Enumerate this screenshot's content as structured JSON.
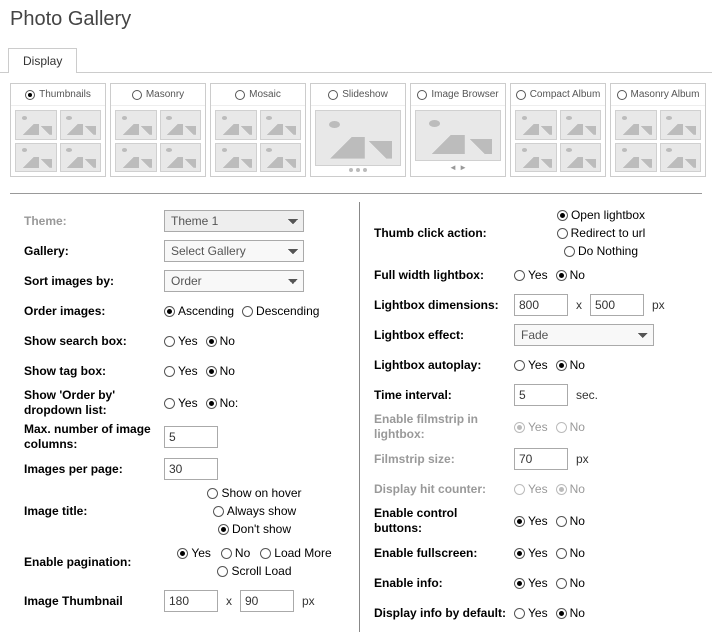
{
  "page_title": "Photo Gallery",
  "tab_display": "Display",
  "view_types": [
    {
      "label": "Thumbnails",
      "selected": true,
      "layout": "grid2x2"
    },
    {
      "label": "Masonry",
      "selected": false,
      "layout": "grid2x2"
    },
    {
      "label": "Mosaic",
      "selected": false,
      "layout": "grid2x2"
    },
    {
      "label": "Slideshow",
      "selected": false,
      "layout": "single_dots"
    },
    {
      "label": "Image Browser",
      "selected": false,
      "layout": "single_arrows"
    },
    {
      "label": "Compact Album",
      "selected": false,
      "layout": "grid2x2"
    },
    {
      "label": "Masonry Album",
      "selected": false,
      "layout": "grid2x2"
    }
  ],
  "left": {
    "theme_label": "Theme:",
    "theme_value": "Theme 1",
    "gallery_label": "Gallery:",
    "gallery_value": "Select Gallery",
    "sort_label": "Sort images by:",
    "sort_value": "Order",
    "order_label": "Order images:",
    "order_asc": "Ascending",
    "order_desc": "Descending",
    "search_label": "Show search box:",
    "tag_label": "Show tag box:",
    "orderby_label": "Show 'Order by' dropdown list:",
    "maxcols_label": "Max. number of image columns:",
    "maxcols_value": "5",
    "perpage_label": "Images per page:",
    "perpage_value": "30",
    "imgtitle_label": "Image title:",
    "imgtitle_hover": "Show on hover",
    "imgtitle_always": "Always show",
    "imgtitle_none": "Don't show",
    "pag_label": "Enable pagination:",
    "pag_loadmore": "Load More",
    "pag_scroll": "Scroll Load",
    "thumbdim_label": "Image Thumbnail",
    "thumb_w": "180",
    "thumb_h": "90",
    "px": "px",
    "x": "x",
    "yes": "Yes",
    "no": "No",
    "no_colon": "No:"
  },
  "right": {
    "click_label": "Thumb click action:",
    "click_open": "Open lightbox",
    "click_redirect": "Redirect to url",
    "click_nothing": "Do Nothing",
    "fullw_label": "Full width lightbox:",
    "lbdim_label": "Lightbox dimensions:",
    "lb_w": "800",
    "lb_h": "500",
    "effect_label": "Lightbox effect:",
    "effect_value": "Fade",
    "autoplay_label": "Lightbox autoplay:",
    "interval_label": "Time interval:",
    "interval_value": "5",
    "sec": "sec.",
    "filmstrip_label": "Enable filmstrip in lightbox:",
    "filmsize_label": "Filmstrip size:",
    "filmsize_value": "70",
    "hit_label": "Display hit counter:",
    "ctrl_label": "Enable control buttons:",
    "fs_label": "Enable fullscreen:",
    "info_label": "Enable info:",
    "infodef_label": "Display info by default:",
    "px": "px",
    "x": "x",
    "yes": "Yes",
    "no": "No"
  }
}
